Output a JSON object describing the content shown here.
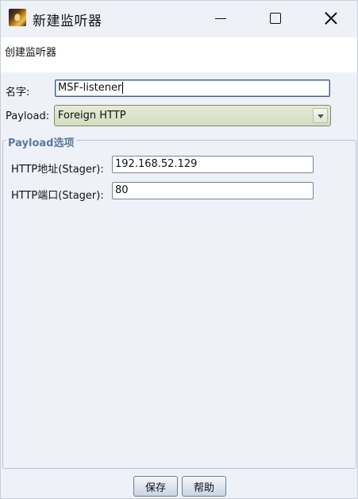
{
  "window": {
    "title": "新建监听器"
  },
  "banner": {
    "text": "创建监听器"
  },
  "form": {
    "name_label": "名字:",
    "name_value": "MSF-listener",
    "payload_label": "Payload:",
    "payload_value": "Foreign HTTP"
  },
  "options": {
    "title": "Payload选项",
    "host_label": "HTTP地址(Stager):",
    "host_value": "192.168.52.129",
    "port_label": "HTTP端口(Stager):",
    "port_value": "80"
  },
  "buttons": {
    "save": "保存",
    "help": "帮助"
  }
}
